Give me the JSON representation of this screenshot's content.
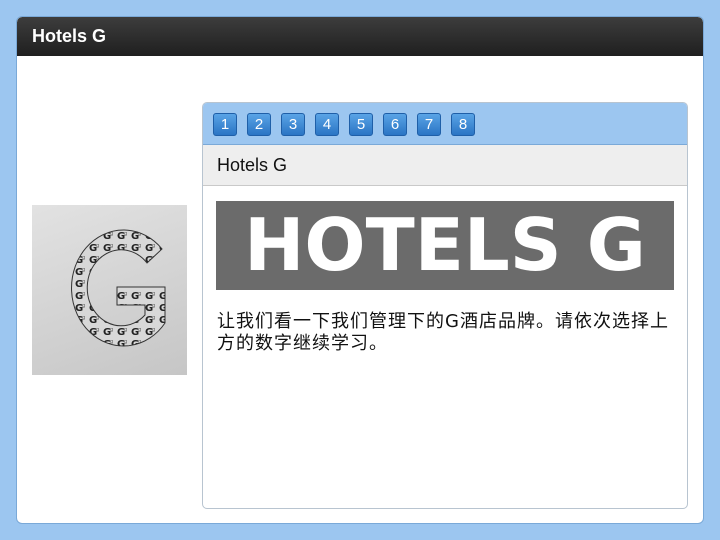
{
  "window": {
    "title": "Hotels G"
  },
  "thumbnail": {
    "icon": "g-letter-collage-icon"
  },
  "pager": {
    "pages": [
      "1",
      "2",
      "3",
      "4",
      "5",
      "6",
      "7",
      "8"
    ]
  },
  "panel": {
    "heading": "Hotels G",
    "banner_text": "HOTELS G",
    "body": "让我们看一下我们管理下的G酒店品牌。请依次选择上方的数字继续学习。"
  },
  "colors": {
    "background": "#9cc6f0",
    "titlebar": "#2b2b2b",
    "page_button": "#3a86d4",
    "banner": "#6b6b6b"
  }
}
